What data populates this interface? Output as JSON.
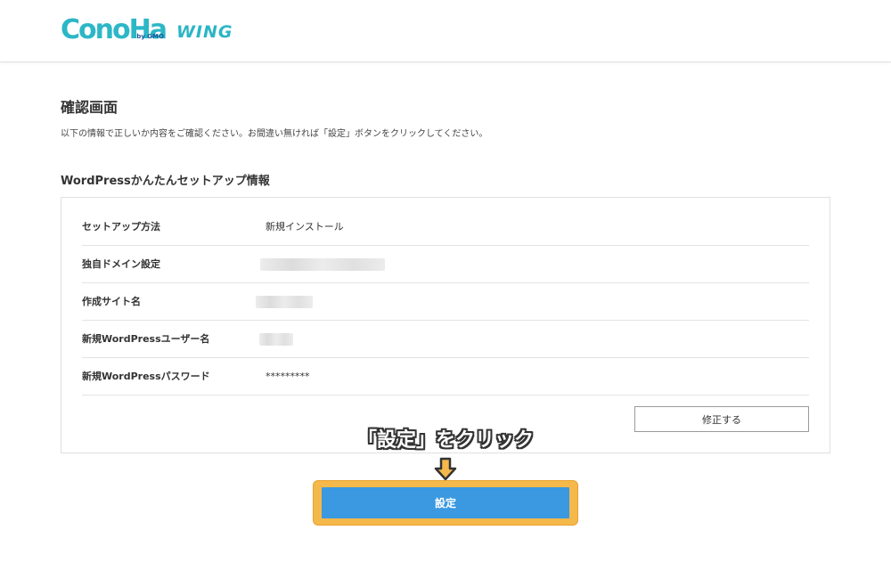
{
  "header": {
    "logo_text": "ConoHa",
    "logo_by": "by GMO",
    "logo_product": "WING"
  },
  "main": {
    "title": "確認画面",
    "description": "以下の情報で正しいか内容をご確認ください。お間違い無ければ「設定」ボタンをクリックしてください。",
    "section_title": "WordPressかんたんセットアップ情報",
    "rows": [
      {
        "label": "セットアップ方法",
        "value": "新規インストール"
      },
      {
        "label": "独自ドメイン設定",
        "value": ""
      },
      {
        "label": "作成サイト名",
        "value": ""
      },
      {
        "label": "新規WordPressユーザー名",
        "value": ""
      },
      {
        "label": "新規WordPressパスワード",
        "value": "*********"
      }
    ],
    "fix_button_label": "修正する",
    "annotation_text": "「設定」をクリック",
    "setup_button_label": "設定"
  },
  "colors": {
    "brand": "#2cb7c7",
    "primary_button": "#3a99e0",
    "highlight": "#f5b84a"
  }
}
